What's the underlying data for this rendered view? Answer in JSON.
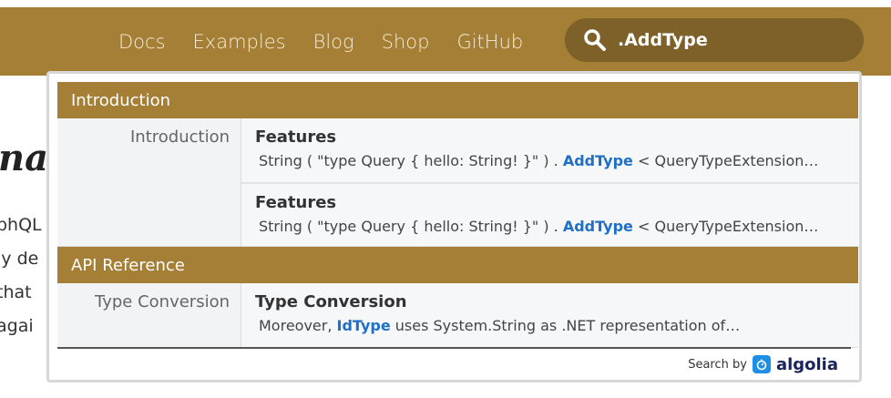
{
  "nav": {
    "items": [
      "Docs",
      "Examples",
      "Blog",
      "Shop",
      "GitHub"
    ]
  },
  "search": {
    "value": ".AddType",
    "icon": "search-icon"
  },
  "background": {
    "heading_fragment": "na",
    "lines": [
      "phQL",
      "ly de",
      "that",
      "agai"
    ]
  },
  "dropdown": {
    "categories": [
      {
        "label": "Introduction",
        "subcategory": "Introduction",
        "results": [
          {
            "title": "Features",
            "snippet_pre": "String ( \"type Query { hello: String! }\" ) . ",
            "highlight": "AddType",
            "snippet_post": " < QueryTypeExtension…"
          },
          {
            "title": "Features",
            "snippet_pre": "String ( \"type Query { hello: String! }\" ) . ",
            "highlight": "AddType",
            "snippet_post": " < QueryTypeExtension…"
          }
        ]
      },
      {
        "label": "API Reference",
        "subcategory": "Type Conversion",
        "results": [
          {
            "title": "Type Conversion",
            "snippet_pre": "Moreover, ",
            "highlight": "IdType",
            "snippet_post": " uses System.String as .NET representation of…"
          }
        ]
      }
    ],
    "footer": {
      "search_by": "Search by",
      "brand": "algolia"
    }
  },
  "colors": {
    "brand": "#a47f35",
    "search_bg": "#7e6128",
    "highlight": "#1e6fc8"
  }
}
